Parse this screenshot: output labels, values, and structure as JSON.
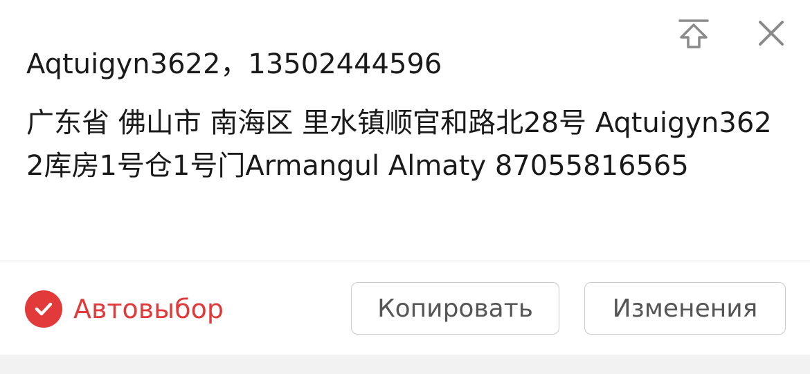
{
  "address_card": {
    "name_phone": "Aqtuigyn3622，13502444596",
    "address": "广东省 佛山市 南海区 里水镇顺官和路北28号 Aqtuigyn3622库房1号仓1号门Armangul Almaty 87055816565",
    "icons": {
      "pin_top": "pin-to-top-icon",
      "close": "close-icon",
      "check": "check-circle-icon"
    }
  },
  "bottom_bar": {
    "auto_select_label": "Автовыбор",
    "copy_label": "Копировать",
    "edit_label": "Изменения"
  },
  "colors": {
    "accent": "#e23a3a",
    "text": "#1a1a1a",
    "button_text": "#555555",
    "icon": "#8a8a8a"
  }
}
